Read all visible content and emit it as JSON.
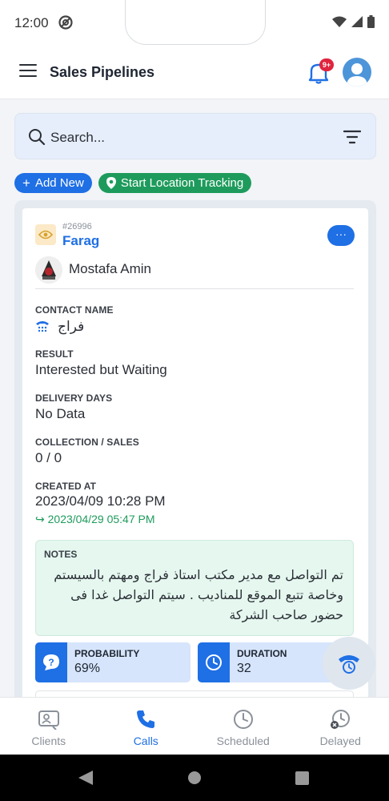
{
  "status_bar": {
    "time": "12:00",
    "icons": [
      "dnd-icon",
      "wifi-icon",
      "signal-icon",
      "battery-icon"
    ]
  },
  "app_bar": {
    "title": "Sales Pipelines",
    "notification_badge": "9+"
  },
  "search": {
    "placeholder": "Search..."
  },
  "actions": {
    "add_new": "Add New",
    "start_tracking": "Start Location Tracking"
  },
  "deal": {
    "id": "#26996",
    "name": "Farag",
    "owner": "Mostafa Amin",
    "contact_label": "CONTACT NAME",
    "contact_value": "فراج",
    "result_label": "RESULT",
    "result_value": "Interested but Waiting",
    "delivery_label": "DELIVERY DAYS",
    "delivery_value": "No Data",
    "collection_label": "COLLECTION / SALES",
    "collection_value": "0 / 0",
    "created_label": "CREATED AT",
    "created_value": "2023/04/09 10:28 PM",
    "updated_value": "2023/04/29 05:47 PM",
    "notes_label": "NOTES",
    "notes_value": "تم التواصل مع مدير مكتب استاذ فراج ومهتم بالسيستم وخاصة تتبع الموقع للمناديب . سيتم التواصل غدا فى حضور صاحب الشركة",
    "probability_label": "PROBABILITY",
    "probability_value": "69%",
    "duration_label": "DURATION",
    "duration_value": "32"
  },
  "tabs": [
    {
      "label": "Clients",
      "icon": "clients-icon"
    },
    {
      "label": "Calls",
      "icon": "phone-icon",
      "active": true
    },
    {
      "label": "Scheduled",
      "icon": "clock-icon"
    },
    {
      "label": "Delayed",
      "icon": "delayed-clock-icon"
    }
  ],
  "colors": {
    "primary": "#1f6fe5",
    "success": "#1e9b5c",
    "badge": "#e0243d"
  }
}
